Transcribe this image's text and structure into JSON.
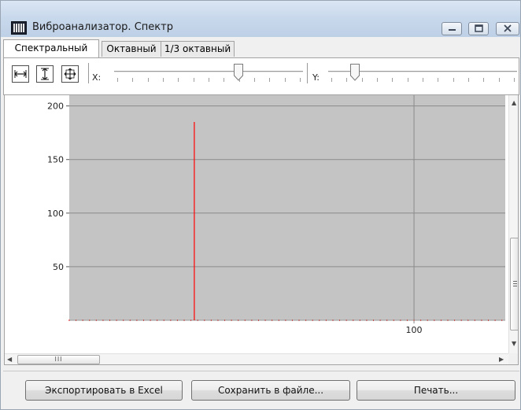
{
  "window": {
    "title": "Виброанализатор. Спектр",
    "icon": "app-spectrum-icon",
    "controls": [
      "minimize-icon",
      "maximize-icon",
      "close-icon"
    ]
  },
  "tabs": [
    {
      "label": "Спектральный",
      "active": true
    },
    {
      "label": "Октавный",
      "active": false
    },
    {
      "label": "1/3 октавный",
      "active": false
    }
  ],
  "toolbar": {
    "zoom_buttons": [
      "zoom-horizontal-icon",
      "zoom-vertical-icon",
      "zoom-both-icon"
    ],
    "x_label": "X:",
    "y_label": "Y:",
    "x_slider_level": 0.67,
    "y_slider_level": 0.12
  },
  "chart_data": {
    "type": "bar",
    "title": "",
    "xlabel": "",
    "ylabel": "",
    "x_tick_labels": [
      "100"
    ],
    "y_tick_labels": [
      "200",
      "150",
      "100",
      "50"
    ],
    "xlim": [
      -2,
      127
    ],
    "ylim": [
      0,
      210
    ],
    "grid": true,
    "background": "#c4c4c4",
    "bar_color": "#ff0000",
    "series": [
      {
        "x": 35,
        "y": 185
      }
    ]
  },
  "scrollbars": {
    "horizontal_grip": "III",
    "vertical_grip": "grip-icon"
  },
  "buttons": {
    "export_label": "Экспортировать в Excel",
    "save_label": "Сохранить в файле...",
    "print_label": "Печать..."
  }
}
